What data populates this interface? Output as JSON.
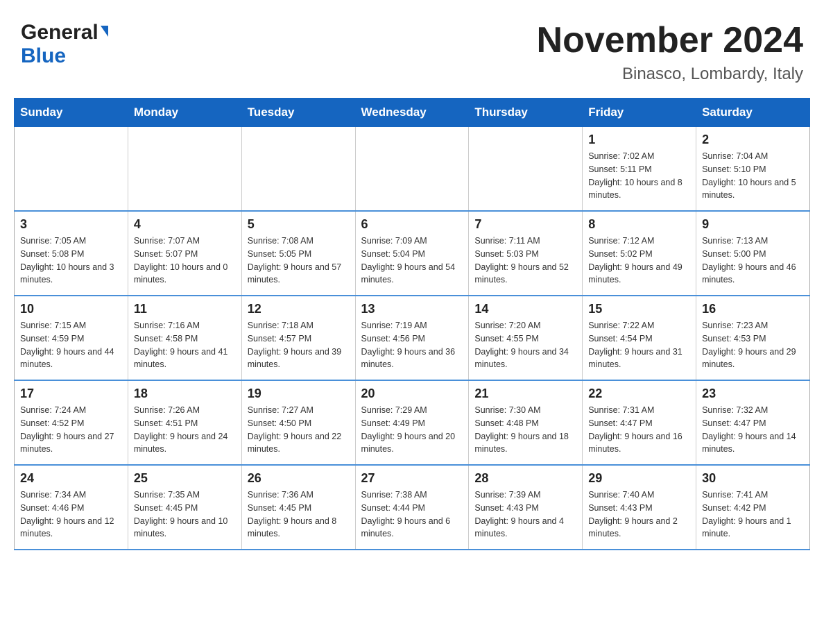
{
  "header": {
    "title": "November 2024",
    "subtitle": "Binasco, Lombardy, Italy",
    "logo_general": "General",
    "logo_blue": "Blue"
  },
  "days_of_week": [
    "Sunday",
    "Monday",
    "Tuesday",
    "Wednesday",
    "Thursday",
    "Friday",
    "Saturday"
  ],
  "weeks": [
    {
      "days": [
        {
          "number": "",
          "info": ""
        },
        {
          "number": "",
          "info": ""
        },
        {
          "number": "",
          "info": ""
        },
        {
          "number": "",
          "info": ""
        },
        {
          "number": "",
          "info": ""
        },
        {
          "number": "1",
          "info": "Sunrise: 7:02 AM\nSunset: 5:11 PM\nDaylight: 10 hours and 8 minutes."
        },
        {
          "number": "2",
          "info": "Sunrise: 7:04 AM\nSunset: 5:10 PM\nDaylight: 10 hours and 5 minutes."
        }
      ]
    },
    {
      "days": [
        {
          "number": "3",
          "info": "Sunrise: 7:05 AM\nSunset: 5:08 PM\nDaylight: 10 hours and 3 minutes."
        },
        {
          "number": "4",
          "info": "Sunrise: 7:07 AM\nSunset: 5:07 PM\nDaylight: 10 hours and 0 minutes."
        },
        {
          "number": "5",
          "info": "Sunrise: 7:08 AM\nSunset: 5:05 PM\nDaylight: 9 hours and 57 minutes."
        },
        {
          "number": "6",
          "info": "Sunrise: 7:09 AM\nSunset: 5:04 PM\nDaylight: 9 hours and 54 minutes."
        },
        {
          "number": "7",
          "info": "Sunrise: 7:11 AM\nSunset: 5:03 PM\nDaylight: 9 hours and 52 minutes."
        },
        {
          "number": "8",
          "info": "Sunrise: 7:12 AM\nSunset: 5:02 PM\nDaylight: 9 hours and 49 minutes."
        },
        {
          "number": "9",
          "info": "Sunrise: 7:13 AM\nSunset: 5:00 PM\nDaylight: 9 hours and 46 minutes."
        }
      ]
    },
    {
      "days": [
        {
          "number": "10",
          "info": "Sunrise: 7:15 AM\nSunset: 4:59 PM\nDaylight: 9 hours and 44 minutes."
        },
        {
          "number": "11",
          "info": "Sunrise: 7:16 AM\nSunset: 4:58 PM\nDaylight: 9 hours and 41 minutes."
        },
        {
          "number": "12",
          "info": "Sunrise: 7:18 AM\nSunset: 4:57 PM\nDaylight: 9 hours and 39 minutes."
        },
        {
          "number": "13",
          "info": "Sunrise: 7:19 AM\nSunset: 4:56 PM\nDaylight: 9 hours and 36 minutes."
        },
        {
          "number": "14",
          "info": "Sunrise: 7:20 AM\nSunset: 4:55 PM\nDaylight: 9 hours and 34 minutes."
        },
        {
          "number": "15",
          "info": "Sunrise: 7:22 AM\nSunset: 4:54 PM\nDaylight: 9 hours and 31 minutes."
        },
        {
          "number": "16",
          "info": "Sunrise: 7:23 AM\nSunset: 4:53 PM\nDaylight: 9 hours and 29 minutes."
        }
      ]
    },
    {
      "days": [
        {
          "number": "17",
          "info": "Sunrise: 7:24 AM\nSunset: 4:52 PM\nDaylight: 9 hours and 27 minutes."
        },
        {
          "number": "18",
          "info": "Sunrise: 7:26 AM\nSunset: 4:51 PM\nDaylight: 9 hours and 24 minutes."
        },
        {
          "number": "19",
          "info": "Sunrise: 7:27 AM\nSunset: 4:50 PM\nDaylight: 9 hours and 22 minutes."
        },
        {
          "number": "20",
          "info": "Sunrise: 7:29 AM\nSunset: 4:49 PM\nDaylight: 9 hours and 20 minutes."
        },
        {
          "number": "21",
          "info": "Sunrise: 7:30 AM\nSunset: 4:48 PM\nDaylight: 9 hours and 18 minutes."
        },
        {
          "number": "22",
          "info": "Sunrise: 7:31 AM\nSunset: 4:47 PM\nDaylight: 9 hours and 16 minutes."
        },
        {
          "number": "23",
          "info": "Sunrise: 7:32 AM\nSunset: 4:47 PM\nDaylight: 9 hours and 14 minutes."
        }
      ]
    },
    {
      "days": [
        {
          "number": "24",
          "info": "Sunrise: 7:34 AM\nSunset: 4:46 PM\nDaylight: 9 hours and 12 minutes."
        },
        {
          "number": "25",
          "info": "Sunrise: 7:35 AM\nSunset: 4:45 PM\nDaylight: 9 hours and 10 minutes."
        },
        {
          "number": "26",
          "info": "Sunrise: 7:36 AM\nSunset: 4:45 PM\nDaylight: 9 hours and 8 minutes."
        },
        {
          "number": "27",
          "info": "Sunrise: 7:38 AM\nSunset: 4:44 PM\nDaylight: 9 hours and 6 minutes."
        },
        {
          "number": "28",
          "info": "Sunrise: 7:39 AM\nSunset: 4:43 PM\nDaylight: 9 hours and 4 minutes."
        },
        {
          "number": "29",
          "info": "Sunrise: 7:40 AM\nSunset: 4:43 PM\nDaylight: 9 hours and 2 minutes."
        },
        {
          "number": "30",
          "info": "Sunrise: 7:41 AM\nSunset: 4:42 PM\nDaylight: 9 hours and 1 minute."
        }
      ]
    }
  ]
}
